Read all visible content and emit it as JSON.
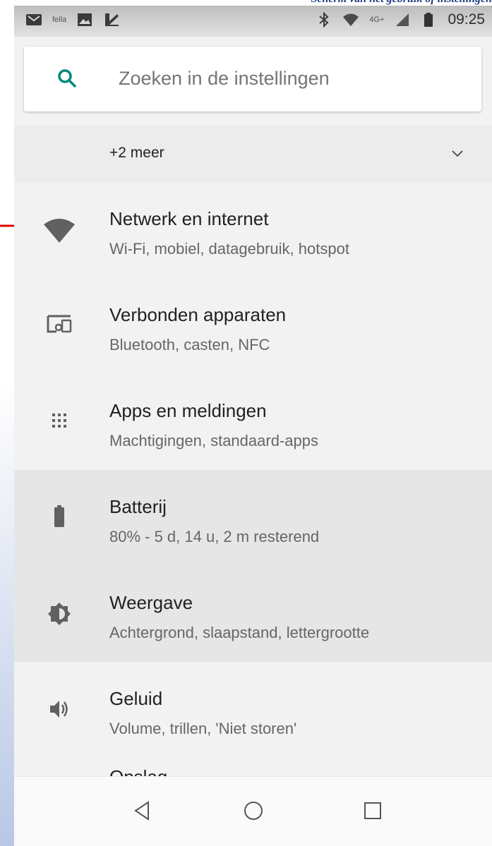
{
  "status_bar": {
    "time": "09:25",
    "left_icons": [
      "gmail-icon",
      "app-icon",
      "image-icon",
      "dispatch-icon"
    ],
    "left_app_text": "fella",
    "right_icons": [
      "bluetooth-icon",
      "wifi-icon",
      "signal-icon",
      "battery-icon"
    ],
    "network_type": "4G+"
  },
  "search": {
    "placeholder": "Zoeken in de instellingen"
  },
  "more": {
    "label": "+2 meer"
  },
  "settings": [
    {
      "title": "Netwerk en internet",
      "subtitle": "Wi-Fi, mobiel, datagebruik, hotspot",
      "icon": "wifi-icon",
      "highlighted": false
    },
    {
      "title": "Verbonden apparaten",
      "subtitle": "Bluetooth, casten, NFC",
      "icon": "devices-icon",
      "highlighted": false
    },
    {
      "title": "Apps en meldingen",
      "subtitle": "Machtigingen, standaard-apps",
      "icon": "apps-icon",
      "highlighted": false
    },
    {
      "title": "Batterij",
      "subtitle": "80% - 5 d, 14 u, 2 m resterend",
      "icon": "battery-icon",
      "highlighted": true
    },
    {
      "title": "Weergave",
      "subtitle": "Achtergrond, slaapstand, lettergrootte",
      "icon": "brightness-icon",
      "highlighted": true
    },
    {
      "title": "Geluid",
      "subtitle": "Volume, trillen, 'Niet storen'",
      "icon": "volume-icon",
      "highlighted": false
    }
  ],
  "cut_item": {
    "title": "Opslag"
  },
  "navbar": {
    "buttons": [
      "back-icon",
      "home-icon",
      "recents-icon"
    ]
  },
  "colors": {
    "accent": "#00897b",
    "icon": "#616161",
    "annotation_arrow": "#e00000"
  }
}
